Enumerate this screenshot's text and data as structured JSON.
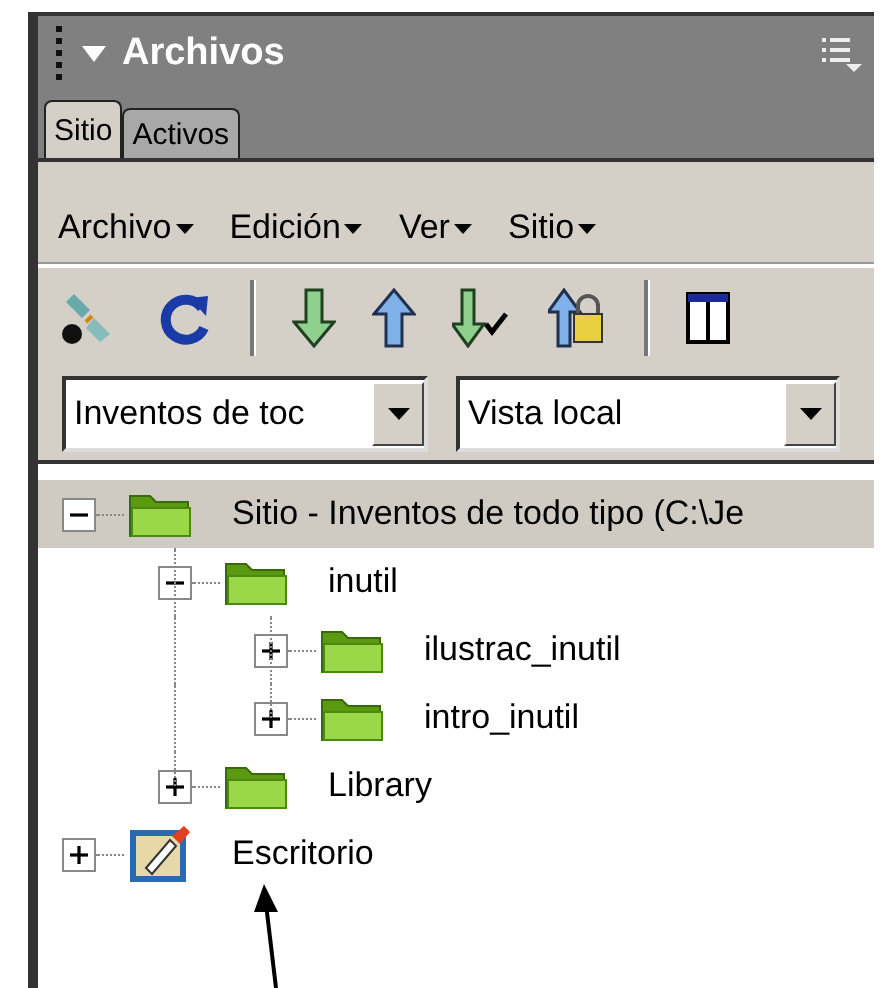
{
  "panel": {
    "title": "Archivos"
  },
  "tabs": [
    {
      "label": "Sitio",
      "selected": true
    },
    {
      "label": "Activos",
      "selected": false
    }
  ],
  "menus": [
    "Archivo",
    "Edición",
    "Ver",
    "Sitio"
  ],
  "selects": [
    {
      "value": "Inventos de toc"
    },
    {
      "value": "Vista local"
    }
  ],
  "tree": [
    {
      "label": "Sitio - Inventos de todo tipo (C:\\Je",
      "kind": "folder",
      "expanded": true,
      "selected": true,
      "children": [
        {
          "label": "inutil",
          "kind": "folder",
          "expanded": true,
          "selected": false,
          "children": [
            {
              "label": "ilustrac_inutil",
              "kind": "folder",
              "expanded": false,
              "selected": false
            },
            {
              "label": "intro_inutil",
              "kind": "folder",
              "expanded": false,
              "selected": false
            }
          ]
        },
        {
          "label": "Library",
          "kind": "folder",
          "expanded": false,
          "selected": false
        }
      ]
    },
    {
      "label": "Escritorio",
      "kind": "desktop",
      "expanded": false,
      "selected": false
    }
  ]
}
